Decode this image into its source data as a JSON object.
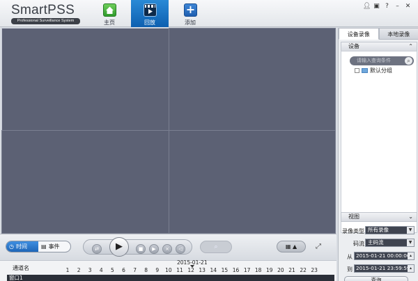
{
  "app": {
    "logo_main": "SmartPSS",
    "logo_tagline": "Professional Surveillance System"
  },
  "nav": {
    "home": "主页",
    "playback": "回放",
    "add": "添加"
  },
  "window_controls": [
    "user-icon",
    "lock-icon",
    "help-icon",
    "minimize-icon",
    "close-icon"
  ],
  "controls": {
    "mode_time": "时间",
    "mode_event": "事件"
  },
  "timeline": {
    "date": "2015-01-21",
    "channel_header": "通道名",
    "hours": [
      "1",
      "2",
      "3",
      "4",
      "5",
      "6",
      "7",
      "8",
      "9",
      "10",
      "11",
      "12",
      "13",
      "14",
      "15",
      "16",
      "17",
      "18",
      "19",
      "20",
      "21",
      "22",
      "23"
    ],
    "row_label": "窗口1"
  },
  "right_panel": {
    "tabs": [
      "设备录像",
      "本地录像"
    ],
    "device_section": "设备",
    "search_placeholder": "请输入查询条件",
    "tree_root": "默认分组",
    "view_section": "视图",
    "record_type_label": "录像类型",
    "record_type_value": "所有录像",
    "stream_label": "码流",
    "stream_value": "主码流",
    "from_label": "从",
    "from_value": "2015-01-21 00:00:00",
    "to_label": "到",
    "to_value": "2015-01-21 23:59:59",
    "query_button": "查询"
  },
  "colors": {
    "video_bg": "#5c6174",
    "accent_blue": "#1f66b8",
    "selected_border": "#c9cdd8"
  }
}
